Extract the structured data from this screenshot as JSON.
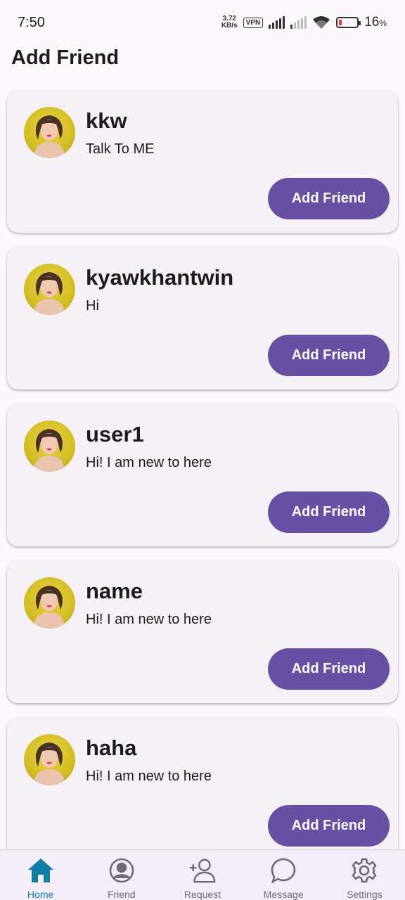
{
  "status_bar": {
    "time": "7:50",
    "net_speed_value": "3.72",
    "net_speed_unit": "KB/s",
    "vpn": "VPN",
    "battery_percent": "16",
    "battery_unit": "%",
    "battery_level": 0.16
  },
  "page": {
    "title": "Add Friend"
  },
  "users": [
    {
      "name": "kkw",
      "bio": "Talk To ME",
      "button_label": "Add Friend"
    },
    {
      "name": "kyawkhantwin",
      "bio": "Hi",
      "button_label": "Add Friend"
    },
    {
      "name": "user1",
      "bio": "Hi! I am new to here",
      "button_label": "Add Friend"
    },
    {
      "name": "name",
      "bio": "Hi! I am new to here",
      "button_label": "Add Friend"
    },
    {
      "name": "haha",
      "bio": "Hi! I am new to here",
      "button_label": "Add Friend"
    }
  ],
  "bottom_nav": {
    "items": [
      {
        "label": "Home",
        "icon": "home-icon",
        "active": true
      },
      {
        "label": "Friend",
        "icon": "account-circle-icon",
        "active": false
      },
      {
        "label": "Request",
        "icon": "person-add-icon",
        "active": false
      },
      {
        "label": "Message",
        "icon": "chat-bubble-icon",
        "active": false
      },
      {
        "label": "Settings",
        "icon": "gear-icon",
        "active": false
      }
    ]
  },
  "colors": {
    "accent": "#6750a4",
    "nav_active": "#0f7fa7",
    "card_bg": "#f6f1f7",
    "page_bg": "#fdf8fd"
  }
}
